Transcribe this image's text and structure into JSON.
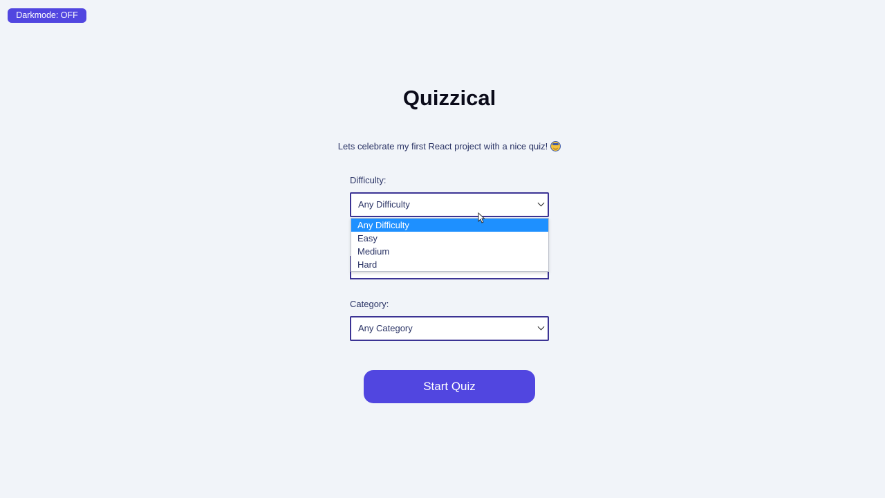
{
  "darkmode_toggle": {
    "label": "Darkmode: OFF"
  },
  "header": {
    "title": "Quizzical",
    "tagline": "Lets celebrate my first React project with a nice quiz!",
    "tagline_emoji": "nerd-face-emoji"
  },
  "form": {
    "difficulty": {
      "label": "Difficulty:",
      "selected": "Any Difficulty",
      "options": [
        "Any Difficulty",
        "Easy",
        "Medium",
        "Hard"
      ],
      "highlighted_option": "Any Difficulty",
      "open": true
    },
    "category": {
      "label": "Category:",
      "selected": "Any Category"
    },
    "start_button": {
      "label": "Start Quiz"
    }
  },
  "colors": {
    "background": "#f1f4f9",
    "accent": "#5146e0",
    "select_border": "#3b3394",
    "option_highlight": "#1e90ff",
    "text": "#293264"
  }
}
